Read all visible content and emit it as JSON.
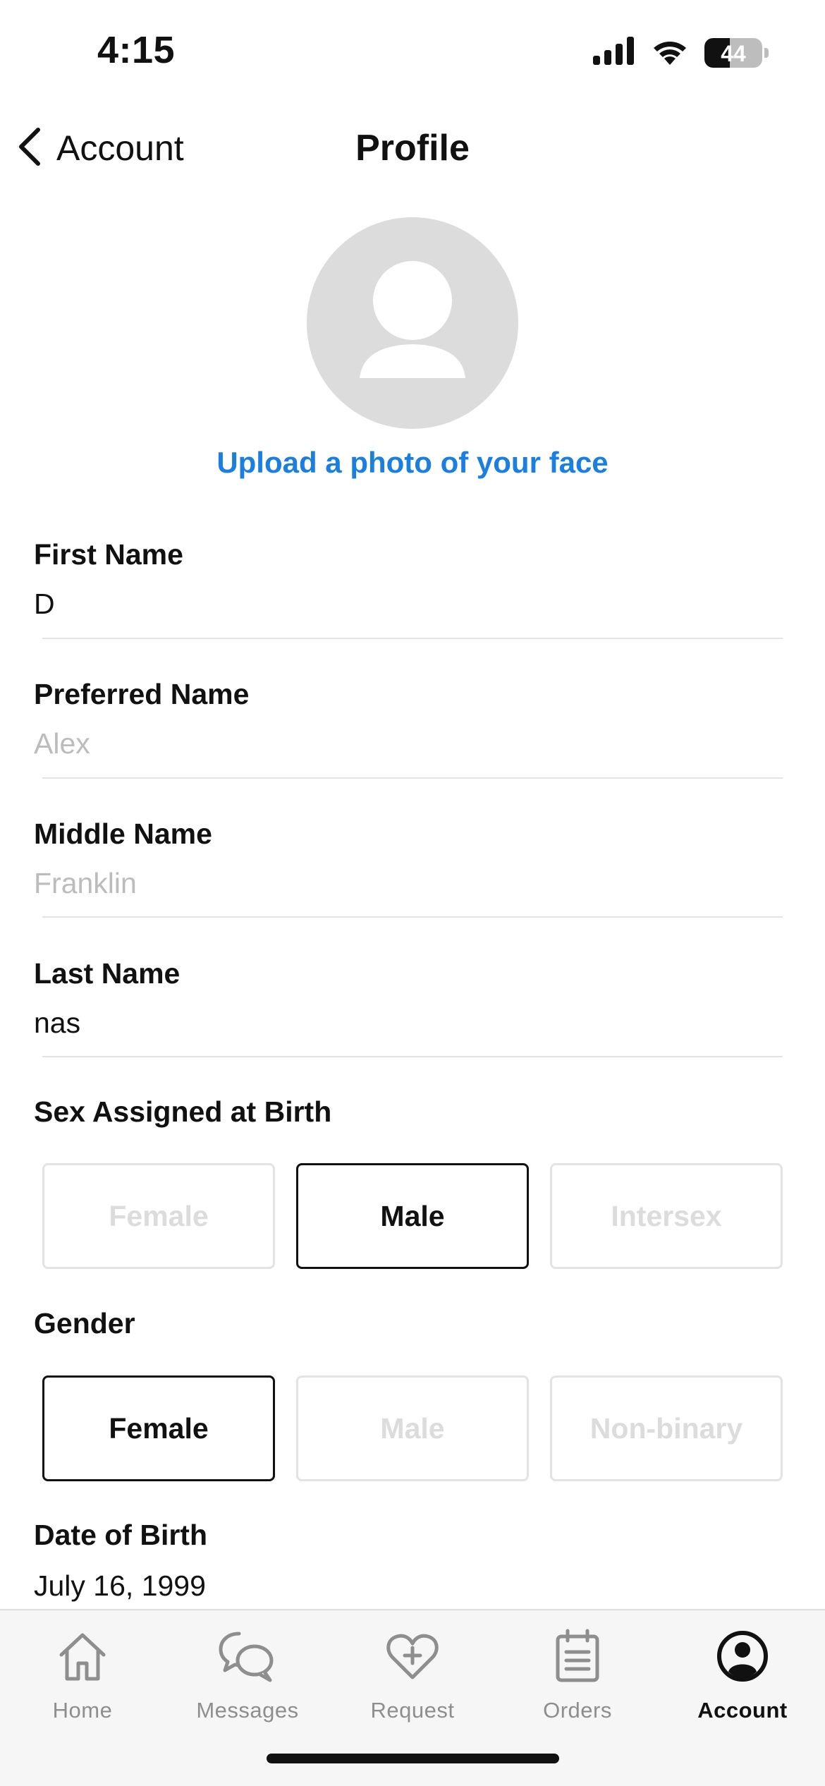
{
  "status_bar": {
    "time": "4:15",
    "battery_level": "44",
    "battery_fraction": 0.44
  },
  "nav": {
    "back_label": "Account",
    "title": "Profile"
  },
  "avatar": {
    "upload_label": "Upload a photo of your face"
  },
  "fields": {
    "first_name": {
      "label": "First Name",
      "value": "D",
      "placeholder": ""
    },
    "preferred_name": {
      "label": "Preferred Name",
      "value": "",
      "placeholder": "Alex"
    },
    "middle_name": {
      "label": "Middle Name",
      "value": "",
      "placeholder": "Franklin"
    },
    "last_name": {
      "label": "Last Name",
      "value": "nas",
      "placeholder": ""
    }
  },
  "sex_assigned": {
    "label": "Sex Assigned at Birth",
    "options": [
      "Female",
      "Male",
      "Intersex"
    ],
    "selected": "Male"
  },
  "gender": {
    "label": "Gender",
    "options": [
      "Female",
      "Male",
      "Non-binary"
    ],
    "selected": "Female"
  },
  "dob": {
    "label": "Date of Birth",
    "value": "July 16, 1999"
  },
  "tab_bar": {
    "items": [
      {
        "label": "Home",
        "icon": "home-icon"
      },
      {
        "label": "Messages",
        "icon": "messages-icon"
      },
      {
        "label": "Request",
        "icon": "heart-plus-icon"
      },
      {
        "label": "Orders",
        "icon": "clipboard-icon"
      },
      {
        "label": "Account",
        "icon": "account-icon"
      }
    ],
    "active": "Account"
  },
  "colors": {
    "accent": "#1a7fe0",
    "text": "#111111",
    "placeholder": "#bcbcbc",
    "unselected_option_text": "#dcdcdc",
    "tab_inactive": "#8e8e8e",
    "avatar_bg": "#dcdcdc"
  }
}
